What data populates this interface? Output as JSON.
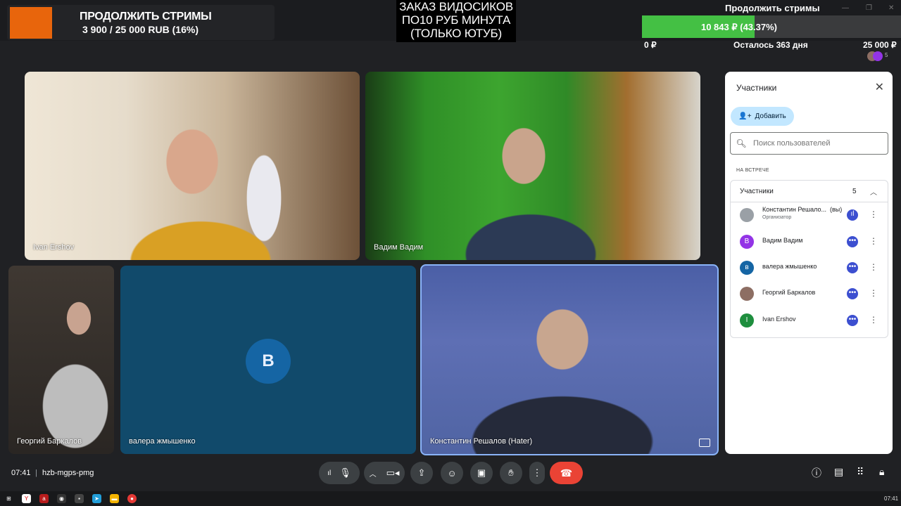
{
  "overlay": {
    "donation_title": "ПРОДОЛЖИТЬ СТРИМЫ",
    "donation_amount": "3 900 / 25 000 RUB (16%)",
    "browser_tab": "hzb-mgps-pmg",
    "order_lines": [
      "ЗАКАЗ ВИДОСИКОВ",
      "ПО10 РУБ МИНУТА",
      "(ТОЛЬКО ЮТУБ)"
    ],
    "goal": {
      "title": "Продолжить стримы",
      "value": "10 843 ₽ (43.37%)",
      "progress": 0.4337,
      "min": "0 ₽",
      "remaining": "Осталось 363 дня",
      "max": "25 000 ₽"
    },
    "participant_count_badge": "5"
  },
  "tiles": {
    "ivan": "Ivan Ershov",
    "vadim": "Вадим Вадим",
    "georgy": "Георгий Баркалов",
    "valera": "валера жмышенко",
    "valera_initial": "В",
    "konstantin": "Константин Решалов (Hater)"
  },
  "panel": {
    "title": "Участники",
    "add_button": "Добавить",
    "search_placeholder": "Поиск пользователей",
    "section_label": "НА ВСТРЕЧЕ",
    "group_label": "Участники",
    "group_count": "5",
    "participants": [
      {
        "name": "Константин Решало...",
        "you": "(вы)",
        "role": "Организатор",
        "initial": "",
        "color": "#9aa0a6"
      },
      {
        "name": "Вадим Вадим",
        "initial": "В",
        "color": "#9334e6"
      },
      {
        "name": "валера жмышенко",
        "initial": "в",
        "color": "#1565a4"
      },
      {
        "name": "Георгий Баркалов",
        "initial": "",
        "color": "#8d6e63"
      },
      {
        "name": "Ivan Ershov",
        "initial": "I",
        "color": "#1e8e3e"
      }
    ]
  },
  "bottom": {
    "time": "07:41",
    "separator": "|",
    "meeting_code": "hzb-mgps-pmg"
  },
  "taskbar": {
    "clock": "07:41"
  }
}
